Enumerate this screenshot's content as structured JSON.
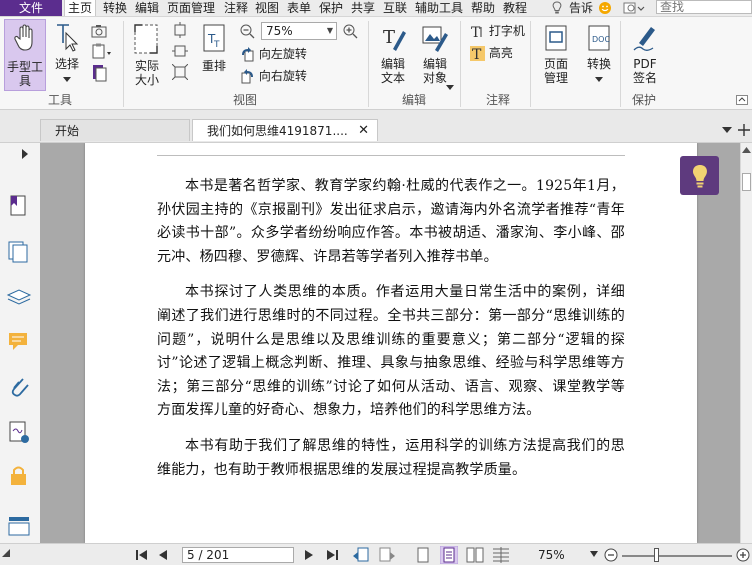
{
  "menu": {
    "file": "文件",
    "items": [
      "主页",
      "转换",
      "编辑",
      "页面管理",
      "注释",
      "视图",
      "表单",
      "保护",
      "共享",
      "互联",
      "辅助工具",
      "帮助",
      "教程"
    ],
    "tell_me": "告诉",
    "search_placeholder": "查找"
  },
  "ribbon": {
    "hand_tool": "手型工具",
    "select": "选择",
    "group_tools": "工具",
    "actual_size": "实际大小",
    "reflow": "重排",
    "zoom": "75%",
    "rotate_left": "向左旋转",
    "rotate_right": "向右旋转",
    "group_view": "视图",
    "edit_text": "编辑文本",
    "edit_object": "编辑对象",
    "group_edit": "编辑",
    "typewriter": "打字机",
    "highlight": "高亮",
    "group_comment": "注释",
    "page_manage": "页面管理",
    "convert": "转换",
    "pdf_sign": "PDF签名",
    "group_protect": "保护"
  },
  "tabs": {
    "start": "开始",
    "document": "我们如何思维4191871...."
  },
  "document": {
    "paragraphs": [
      "本书是著名哲学家、教育学家约翰·杜威的代表作之一。1925年1月，孙伏园主持的《京报副刊》发出征求启示，邀请海内外名流学者推荐“青年必读书十部”。众多学者纷纷响应作答。本书被胡适、潘家洵、李小峰、邵元冲、杨四穆、罗德辉、许昂若等学者列入推荐书单。",
      "本书探讨了人类思维的本质。作者运用大量日常生活中的案例，详细阐述了我们进行思维时的不同过程。全书共三部分：第一部分“思维训练的问题”，说明什么是思维以及思维训练的重要意义；第二部分“逻辑的探讨”论述了逻辑上概念判断、推理、具象与抽象思维、经验与科学思维等方法；第三部分“思维的训练”讨论了如何从活动、语言、观察、课堂教学等方面发挥儿童的好奇心、想象力，培养他们的科学思维方法。",
      "本书有助于我们了解思维的特性，运用科学的训练方法提高我们的思维能力，也有助于教师根据思维的发展过程提高教学质量。"
    ]
  },
  "status": {
    "page": "5 / 201",
    "zoom": "75%"
  },
  "colors": {
    "accent": "#5b2d8e",
    "tip": "#5e3a7e",
    "tip_bulb": "#f2d372"
  }
}
